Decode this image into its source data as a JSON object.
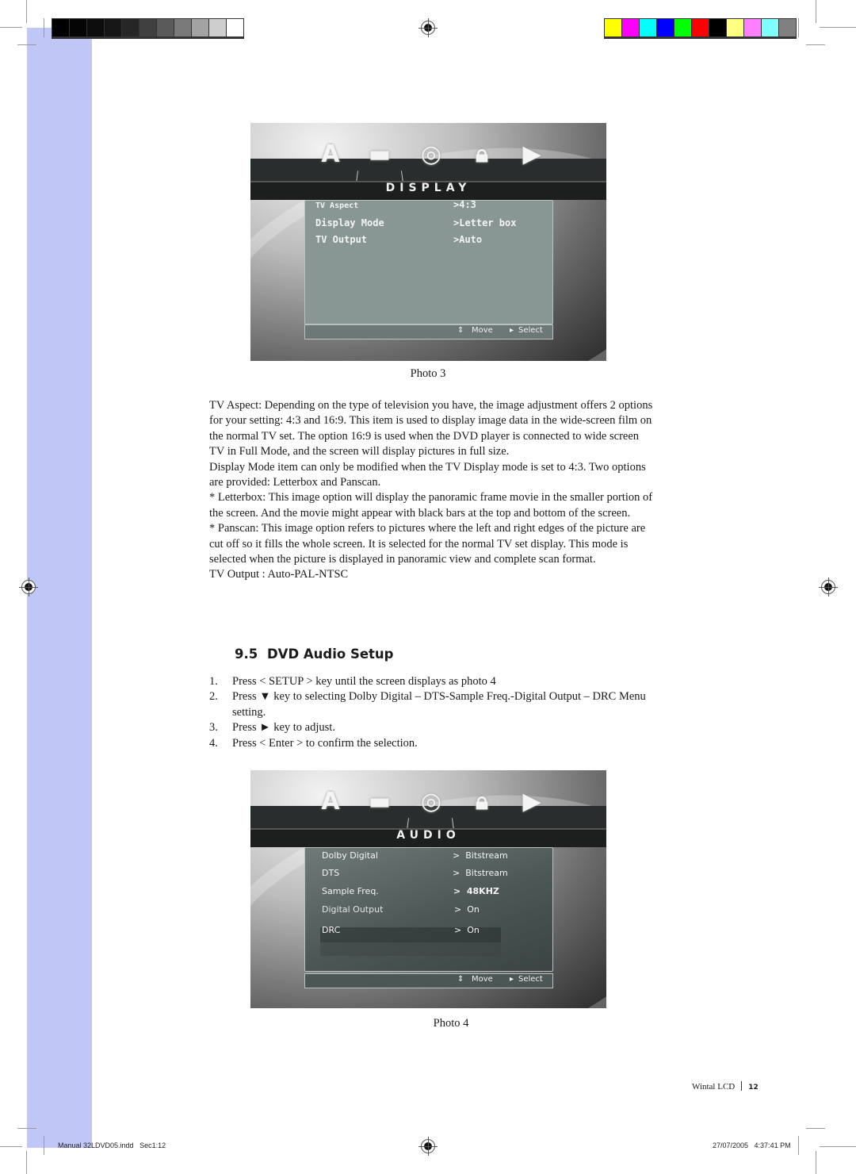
{
  "printer_marks": {
    "grayscale_bar": [
      "#000000",
      "#050505",
      "#0d0d0d",
      "#171717",
      "#262626",
      "#404040",
      "#5a5a5a",
      "#7a7a7a",
      "#a3a3a3",
      "#cecece",
      "#ffffff"
    ],
    "color_bar": [
      "#ffff00",
      "#ff00ff",
      "#00ffff",
      "#0000ff",
      "#00ff00",
      "#ff0000",
      "#000000",
      "#ffff80",
      "#ff80ff",
      "#80ffff",
      "#808080"
    ],
    "side_tab_color": "#c0c6f5"
  },
  "photo3": {
    "menu_title": "DISPLAY",
    "icons": [
      "language-icon",
      "display-icon",
      "audio-icon",
      "lock-icon",
      "preference-icon"
    ],
    "selected_icon": "display-icon",
    "rows": [
      {
        "label": "TV Aspect",
        "value": ">4:3"
      },
      {
        "label": "Display Mode",
        "value": ">Letter box"
      },
      {
        "label": "TV Output",
        "value": ">Auto"
      }
    ],
    "footer": {
      "move": "Move",
      "select": "Select"
    },
    "caption": "Photo 3"
  },
  "description": {
    "paragraphs": [
      "TV Aspect: Depending on the type of television you have, the image adjustment offers 2 options for your setting: 4:3 and 16:9. This item is used to display image data in the wide-screen film on the normal TV set. The option 16:9 is used when the DVD player is connected to wide screen TV in Full Mode, and the screen will display pictures in full size.",
      "Display Mode item can only be modified when the TV Display mode is set to 4:3. Two options are provided: Letterbox and Panscan.",
      "* Letterbox: This image option will display the panoramic frame movie in the smaller portion of the screen. And the movie might appear with black bars at the top and bottom of the screen.",
      "* Panscan: This image option refers to pictures where the left and right edges of the picture are cut off so it fills the whole screen. It is selected for the normal TV set display. This mode is selected when the picture is displayed in panoramic view and complete scan format.",
      "TV Output : Auto-PAL-NTSC"
    ]
  },
  "section": {
    "number": "9.5",
    "title": "DVD Audio Setup",
    "steps": [
      {
        "n": "1.",
        "text": "Press < SETUP > key until the screen displays as photo 4"
      },
      {
        "n": "2.",
        "text": "Press ▼ key to selecting Dolby Digital – DTS-Sample Freq.-Digital Output – DRC Menu setting."
      },
      {
        "n": "3.",
        "text": "Press ► key to adjust."
      },
      {
        "n": "4.",
        "text": "Press < Enter > to confirm the selection."
      }
    ]
  },
  "photo4": {
    "menu_title": "AUDIO",
    "icons": [
      "language-icon",
      "display-icon",
      "audio-icon",
      "lock-icon",
      "preference-icon"
    ],
    "selected_icon": "audio-icon",
    "rows": [
      {
        "label": "Dolby Digital",
        "value": ">  Bitstream"
      },
      {
        "label": "DTS",
        "value": ">  Bitstream"
      },
      {
        "label": "Sample Freq.",
        "value": ">  48KHZ"
      },
      {
        "label": "Digital Output",
        "value": ">  On"
      },
      {
        "label": "DRC",
        "value": ">  On"
      }
    ],
    "highlighted_row": "DRC",
    "footer": {
      "move": "Move",
      "select": "Select"
    },
    "caption": "Photo 4"
  },
  "folio": {
    "brand": "Wintal LCD",
    "page": "12"
  },
  "slug": {
    "file": "Manual 32LDVD05.indd   Sec1:12",
    "timestamp": "27/07/2005   4:37:41 PM"
  }
}
